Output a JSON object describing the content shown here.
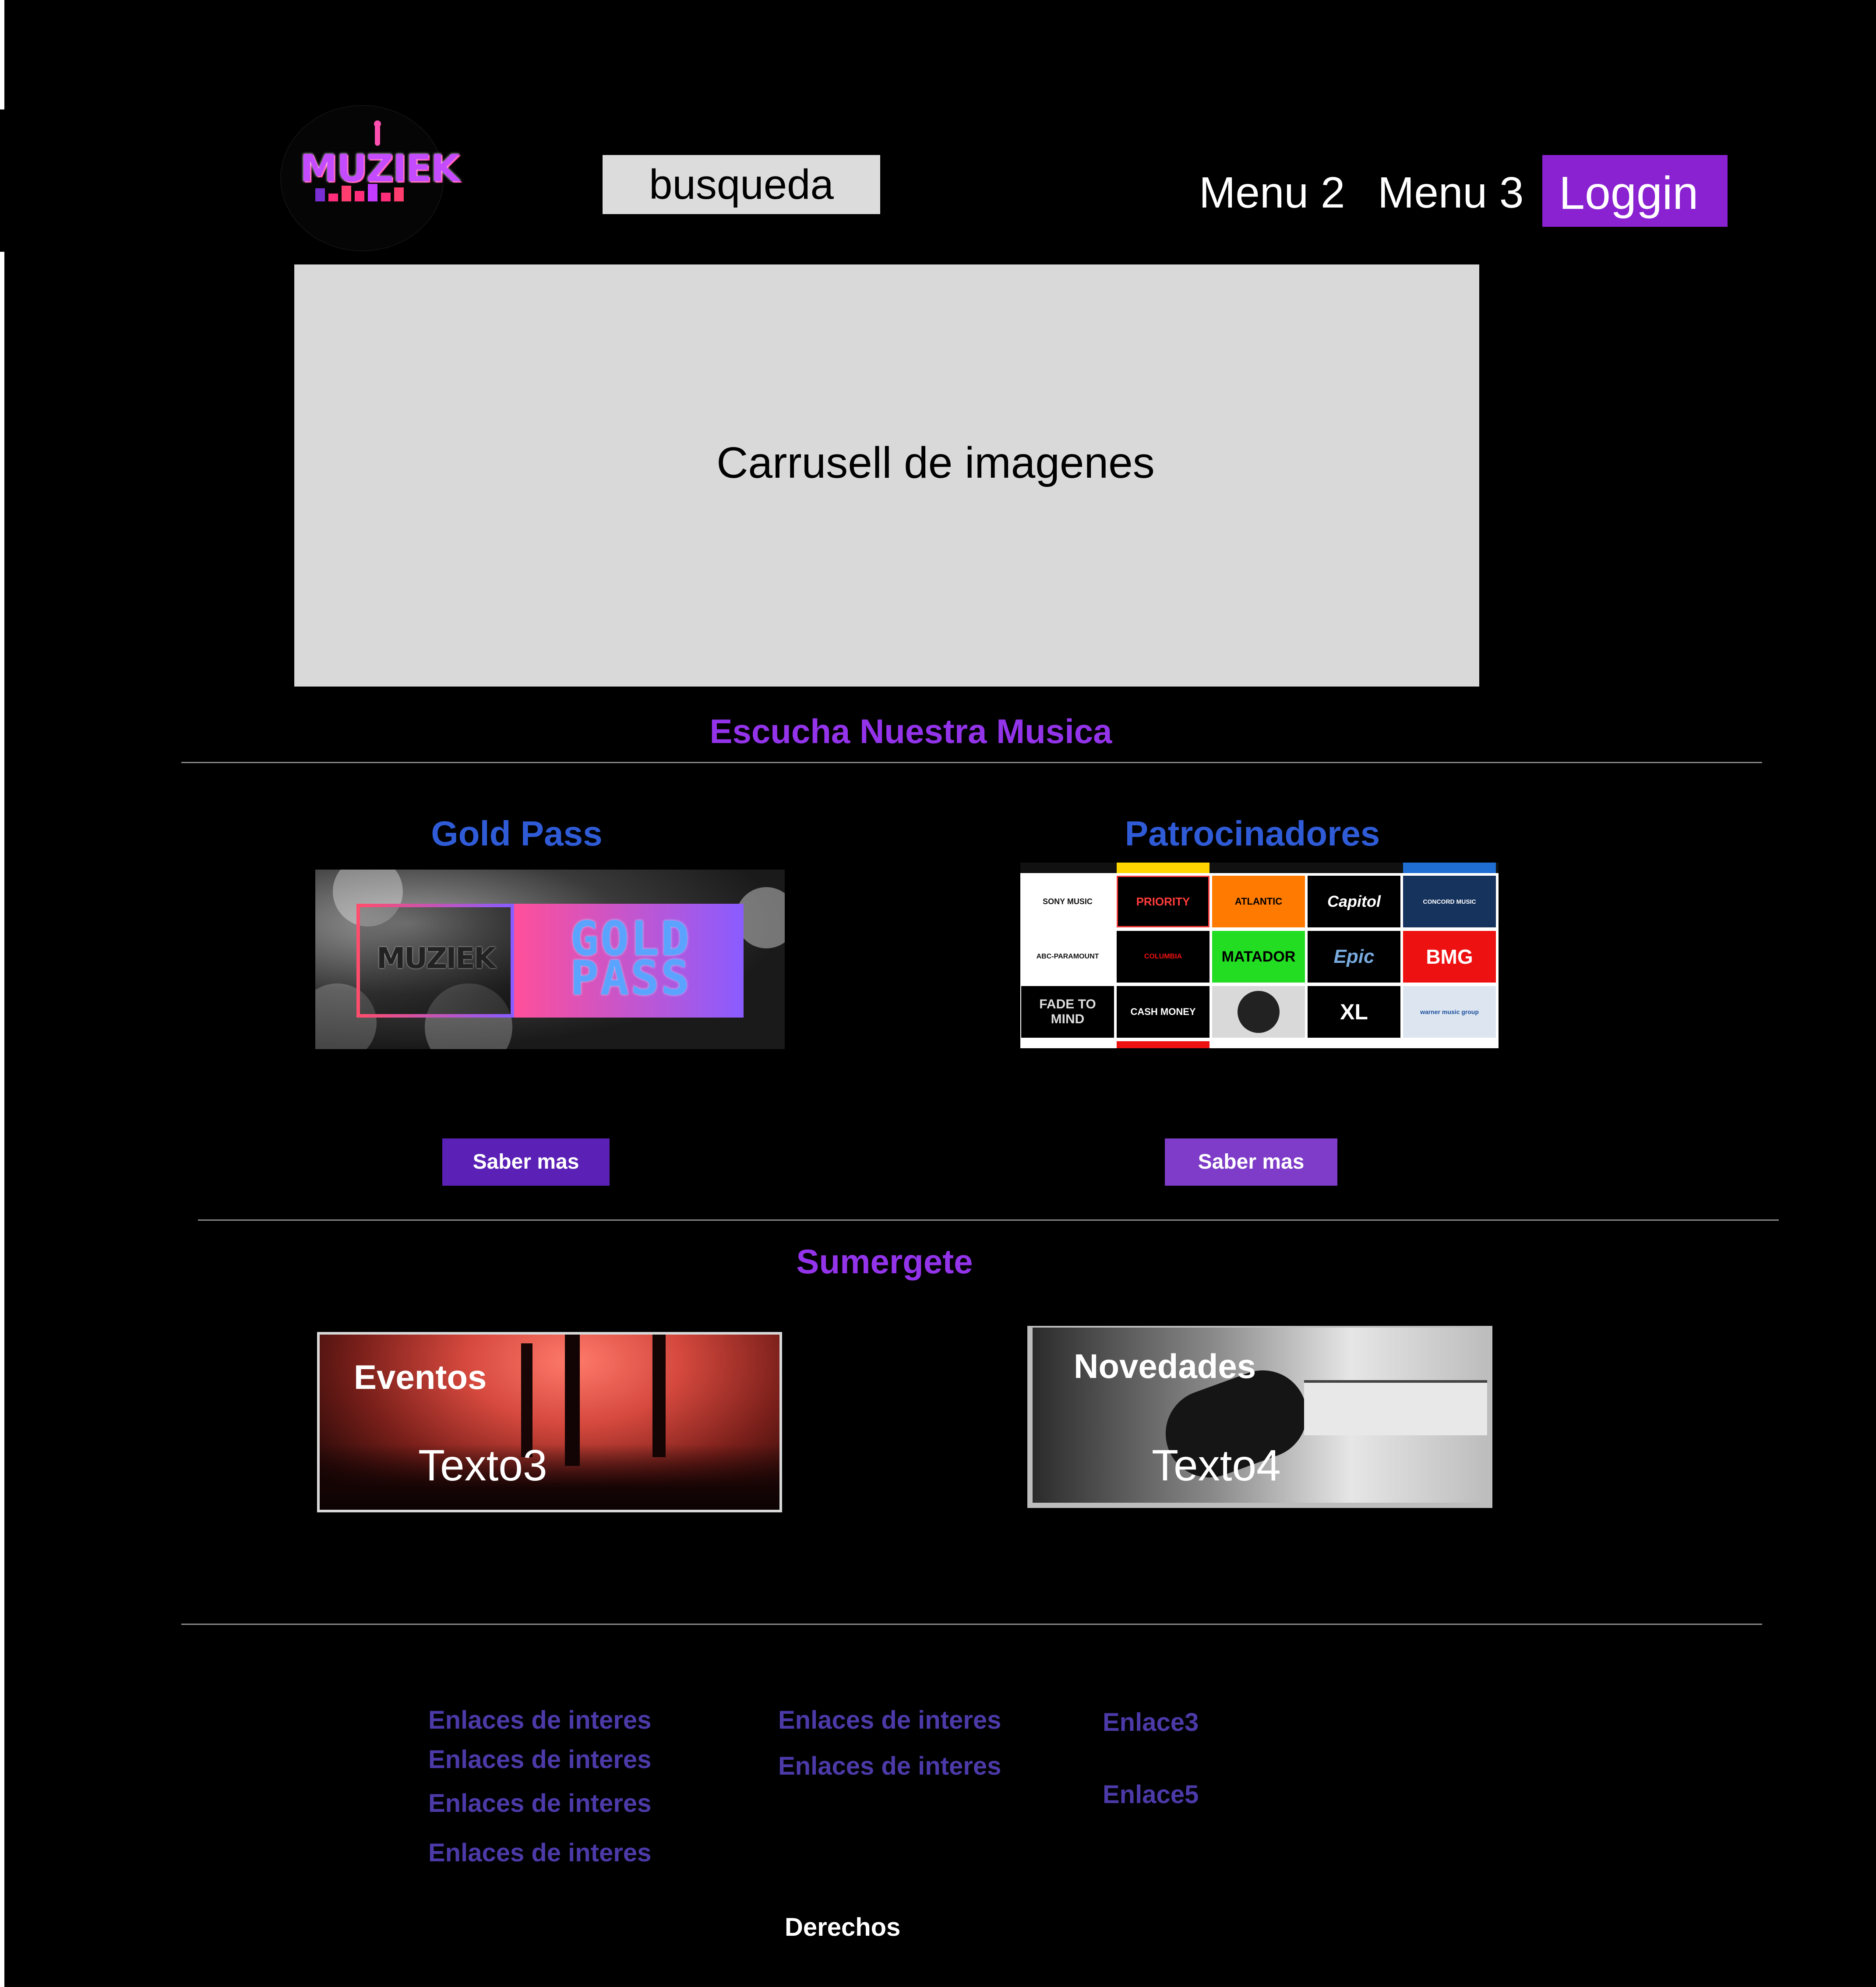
{
  "header": {
    "logo_text": "MUZIEK",
    "search_label": "busqueda",
    "menu": [
      "Menu 2",
      "Menu 3"
    ],
    "login_label": "Loggin"
  },
  "carousel": {
    "label": "Carrusell de imagenes"
  },
  "section_music": {
    "title": "Escucha Nuestra Musica",
    "gold_pass": {
      "title": "Gold Pass",
      "image_left": "MUZIEK",
      "image_right": "GOLD PASS",
      "button": "Saber mas"
    },
    "sponsors": {
      "title": "Patrocinadores",
      "logos": [
        "SONY MUSIC",
        "PRIORITY",
        "ATLANTIC",
        "Capitol",
        "CONCORD MUSIC",
        "ABC-PARAMOUNT",
        "COLUMBIA",
        "MATADOR",
        "Epic",
        "BMG",
        "FADE TO MIND",
        "CASH MONEY",
        "",
        "XL",
        "warner music group"
      ],
      "button": "Saber mas"
    }
  },
  "section_immerse": {
    "title": "Sumergete",
    "events": {
      "title": "Eventos",
      "text": "Texto3"
    },
    "news": {
      "title": "Novedades",
      "text": "Texto4"
    }
  },
  "footer": {
    "col1": [
      "Enlaces de interes",
      "Enlaces de interes",
      "Enlaces de interes",
      "Enlaces de interes"
    ],
    "col2": [
      "Enlaces de interes",
      "Enlaces de interes"
    ],
    "col3": [
      "Enlace3",
      "Enlace5"
    ],
    "rights": "Derechos"
  },
  "colors": {
    "background": "#000000",
    "accent_purple": "#8a22d2",
    "title_purple": "#9333ea",
    "subtitle_blue": "#2f5bd6",
    "link_indigo": "#4b3aa8",
    "button_purple_dark": "#5b21b6",
    "button_purple": "#7e3cc8",
    "carousel_gray": "#d9d9d9"
  }
}
